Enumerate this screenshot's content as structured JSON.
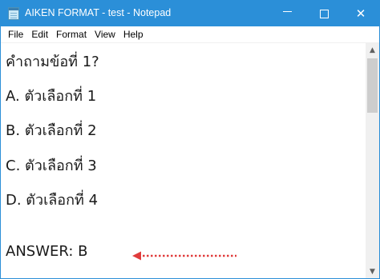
{
  "window": {
    "title": "AIKEN FORMAT - test - Notepad",
    "title_bar_color": "#2b8fd8",
    "controls": {
      "minimize_icon": "minimize-icon",
      "maximize_icon": "maximize-icon",
      "close_glyph": "✕"
    }
  },
  "menu": {
    "items": [
      "File",
      "Edit",
      "Format",
      "View",
      "Help"
    ]
  },
  "document": {
    "lines": [
      "คำถามข้อที่ 1?",
      "A. ตัวเลือกที่ 1",
      "B. ตัวเลือกที่ 2",
      "C. ตัวเลือกที่ 3",
      "D. ตัวเลือกที่ 4",
      "ANSWER: B"
    ]
  },
  "annotation": {
    "arrow_color": "#e03c3c",
    "arrow_icon": "dotted-left-arrow-icon"
  },
  "scrollbar": {
    "up_glyph": "▲",
    "down_glyph": "▼"
  }
}
